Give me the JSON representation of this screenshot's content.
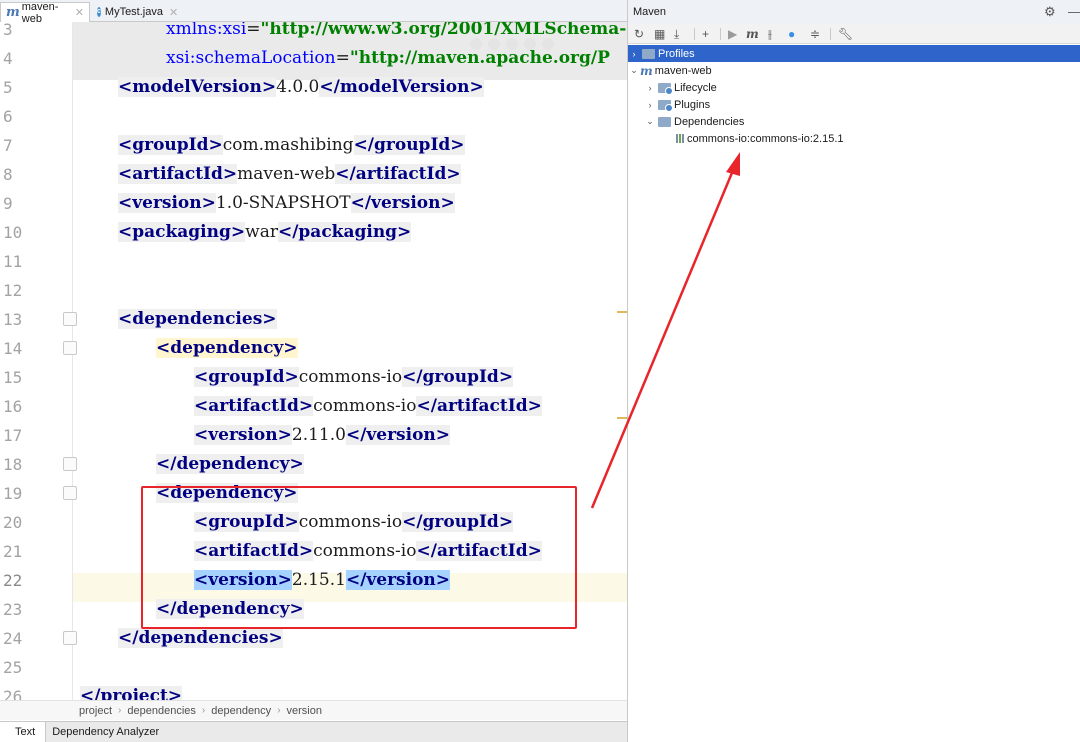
{
  "tabs": [
    {
      "label": "maven-web",
      "icon": "maven-m-icon",
      "active": true
    },
    {
      "label": "MyTest.java",
      "icon": "java-class-icon",
      "active": false
    }
  ],
  "editor": {
    "lines": [
      {
        "no": "3",
        "parts": [
          [
            "xmlns:xsi",
            "at"
          ],
          [
            "=",
            "tx"
          ],
          [
            "\"http://www.w3.org/2001/XMLSchema-",
            "av"
          ]
        ]
      },
      {
        "no": "4",
        "parts": [
          [
            "xsi:schemaLocation",
            "at"
          ],
          [
            "=",
            "tx"
          ],
          [
            "\"http://maven.apache.org/P",
            "av"
          ]
        ]
      },
      {
        "no": "5",
        "parts": [
          [
            "<modelVersion>",
            "tag"
          ],
          [
            "4.0.0",
            "tx"
          ],
          [
            "</modelVersion>",
            "tag"
          ]
        ]
      },
      {
        "no": "6",
        "parts": []
      },
      {
        "no": "7",
        "parts": [
          [
            "<groupId>",
            "tag"
          ],
          [
            "com.mashibing",
            "tx"
          ],
          [
            "</groupId>",
            "tag"
          ]
        ]
      },
      {
        "no": "8",
        "parts": [
          [
            "<artifactId>",
            "tag"
          ],
          [
            "maven-web",
            "tx"
          ],
          [
            "</artifactId>",
            "tag"
          ]
        ]
      },
      {
        "no": "9",
        "parts": [
          [
            "<version>",
            "tag"
          ],
          [
            "1.0-SNAPSHOT",
            "tx"
          ],
          [
            "</version>",
            "tag"
          ]
        ]
      },
      {
        "no": "10",
        "parts": [
          [
            "<packaging>",
            "tag"
          ],
          [
            "war",
            "tx"
          ],
          [
            "</packaging>",
            "tag"
          ]
        ]
      },
      {
        "no": "11",
        "parts": []
      },
      {
        "no": "12",
        "parts": []
      },
      {
        "no": "13",
        "parts": [
          [
            "<dependencies>",
            "tag"
          ]
        ]
      },
      {
        "no": "14",
        "parts": [
          [
            "<dependency>",
            "tagy"
          ]
        ]
      },
      {
        "no": "15",
        "parts": [
          [
            "<groupId>",
            "tag"
          ],
          [
            "commons-io",
            "tx"
          ],
          [
            "</groupId>",
            "tag"
          ]
        ]
      },
      {
        "no": "16",
        "parts": [
          [
            "<artifactId>",
            "tag"
          ],
          [
            "commons-io",
            "tx"
          ],
          [
            "</artifactId>",
            "tag"
          ]
        ]
      },
      {
        "no": "17",
        "parts": [
          [
            "<version>",
            "tag"
          ],
          [
            "2.11.0",
            "tx"
          ],
          [
            "</version>",
            "tag"
          ]
        ]
      },
      {
        "no": "18",
        "parts": [
          [
            "</dependency>",
            "tag"
          ]
        ]
      },
      {
        "no": "19",
        "parts": [
          [
            "<dependency>",
            "tag"
          ]
        ]
      },
      {
        "no": "20",
        "parts": [
          [
            "<groupId>",
            "tag"
          ],
          [
            "commons-io",
            "tx"
          ],
          [
            "</groupId>",
            "tag"
          ]
        ]
      },
      {
        "no": "21",
        "parts": [
          [
            "<artifactId>",
            "tag"
          ],
          [
            "commons-io",
            "tx"
          ],
          [
            "</artifactId>",
            "tag"
          ]
        ]
      },
      {
        "no": "22",
        "parts": [
          [
            "<version>",
            "tags"
          ],
          [
            "2.15.1",
            "tx"
          ],
          [
            "</version>",
            "tags"
          ]
        ]
      },
      {
        "no": "23",
        "parts": [
          [
            "</dependency>",
            "tag"
          ]
        ]
      },
      {
        "no": "24",
        "parts": [
          [
            "</dependencies>",
            "tag"
          ]
        ]
      },
      {
        "no": "25",
        "parts": []
      },
      {
        "no": "26",
        "parts": [
          [
            "</project>",
            "tag"
          ]
        ]
      }
    ]
  },
  "breadcrumb": [
    "project",
    "dependencies",
    "dependency",
    "version"
  ],
  "bottom_tabs": [
    {
      "label": "Text",
      "active": true
    },
    {
      "label": "Dependency Analyzer",
      "active": false
    }
  ],
  "maven": {
    "title": "Maven",
    "toolbar_icons": [
      "reload-icon",
      "generate-sources-icon",
      "download-icon",
      "add-icon",
      "run-icon",
      "execute-goal-icon",
      "toggle-offline-icon",
      "skip-tests-icon",
      "show-dependencies-icon",
      "collapse-all-icon",
      "settings-wrench-icon"
    ],
    "tree": {
      "profiles": "Profiles",
      "project": "maven-web",
      "lifecycle": "Lifecycle",
      "plugins": "Plugins",
      "dependencies": "Dependencies",
      "dependency_item": "commons-io:commons-io:2.15.1"
    }
  },
  "colors": {
    "annotation_red": "#e8252a",
    "selection_blue": "#2f65ca",
    "tag_navy": "#000080"
  }
}
